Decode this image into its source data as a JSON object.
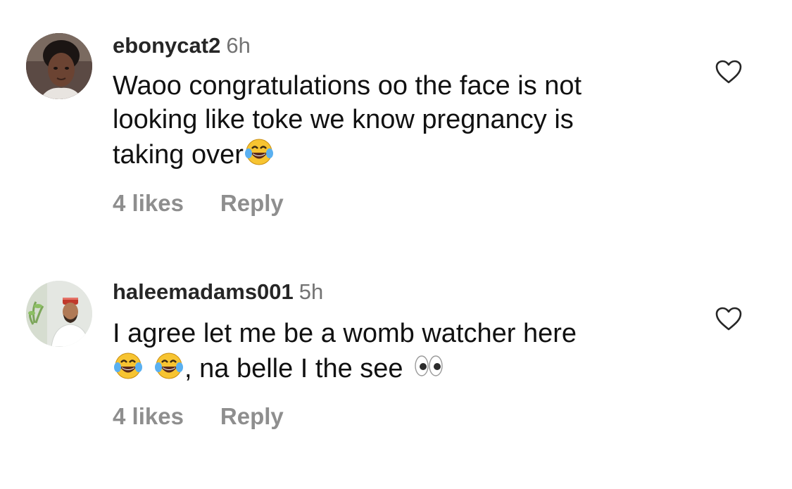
{
  "comments": [
    {
      "username": "ebonycat2",
      "time": "6h",
      "text_lines": [
        "Waoo congratulations oo the face is not",
        "looking like toke we know pregnancy is",
        "taking over"
      ],
      "line3_emoji": "face-with-tears-of-joy",
      "likes": "4 likes",
      "reply": "Reply",
      "like_icon": "heart-outline-icon"
    },
    {
      "username": "haleemadams001",
      "time": "5h",
      "text_lines": [
        "I agree let me be a womb watcher here",
        ", na belle I the see"
      ],
      "line2_emojis": [
        "face-with-tears-of-joy",
        "face-with-tears-of-joy",
        "eyes"
      ],
      "likes": "4 likes",
      "reply": "Reply",
      "like_icon": "heart-outline-icon"
    }
  ],
  "colors": {
    "username": "#262626",
    "timestamp": "#737373",
    "actions": "#8e8e8e",
    "text": "#111111"
  }
}
